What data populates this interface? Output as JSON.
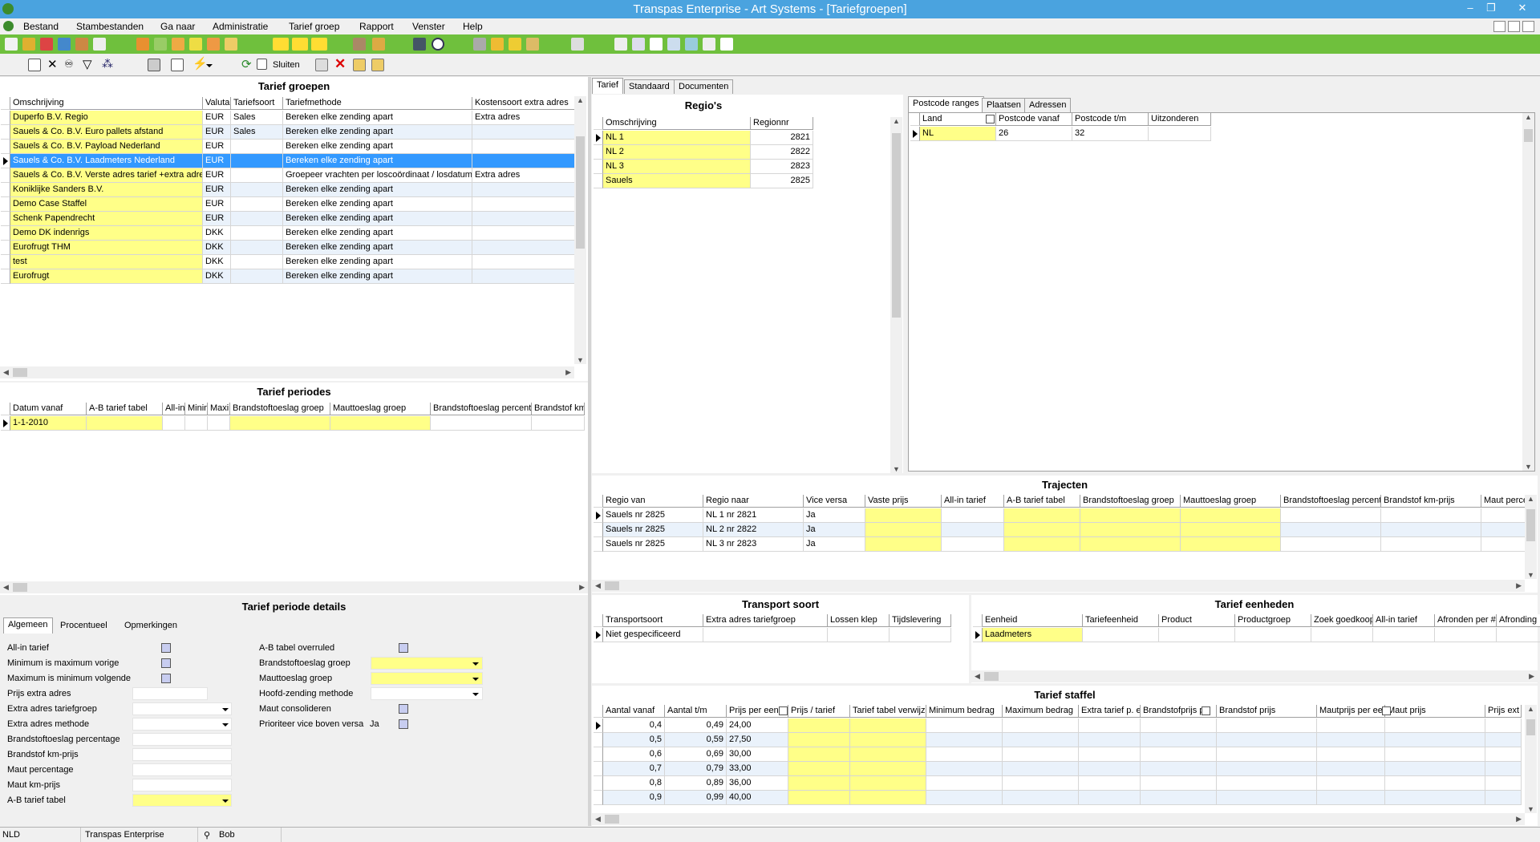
{
  "window": {
    "title": "Transpas Enterprise - Art Systems - [Tariefgroepen]"
  },
  "menu": [
    "Bestand",
    "Stambestanden",
    "Ga naar",
    "Administratie",
    "Tarief groep",
    "Rapport",
    "Venster",
    "Help"
  ],
  "toolbar2": {
    "close_label": "Sluiten"
  },
  "tariefgroepen": {
    "title": "Tarief groepen",
    "columns": [
      "Omschrijving",
      "Valuta",
      "Tariefsoort",
      "Tariefmethode",
      "Kostensoort extra adres"
    ],
    "rows": [
      [
        "Duperfo B.V. Regio",
        "EUR",
        "Sales",
        "Bereken elke zending apart",
        "Extra adres"
      ],
      [
        "Sauels & Co. B.V. Euro pallets afstand",
        "EUR",
        "Sales",
        "Bereken elke zending apart",
        ""
      ],
      [
        "Sauels & Co. B.V. Payload Nederland",
        "EUR",
        "",
        "Bereken elke zending apart",
        ""
      ],
      [
        "Sauels & Co. B.V. Laadmeters Nederland",
        "EUR",
        "",
        "Bereken elke zending apart",
        ""
      ],
      [
        "Sauels & Co. B.V. Verste adres tarief +extra adres",
        "EUR",
        "",
        "Groepeer vrachten per loscoördinaat / losdatum",
        "Extra adres"
      ],
      [
        "Koniklijke Sanders B.V.",
        "EUR",
        "",
        "Bereken elke zending apart",
        ""
      ],
      [
        "Demo Case Staffel",
        "EUR",
        "",
        "Bereken elke zending apart",
        ""
      ],
      [
        "Schenk Papendrecht",
        "EUR",
        "",
        "Bereken elke zending apart",
        ""
      ],
      [
        "Demo DK indenrigs",
        "DKK",
        "",
        "Bereken elke zending apart",
        ""
      ],
      [
        "Eurofrugt THM",
        "DKK",
        "",
        "Bereken elke zending apart",
        ""
      ],
      [
        "test",
        "DKK",
        "",
        "Bereken elke zending apart",
        ""
      ],
      [
        "Eurofrugt",
        "DKK",
        "",
        "Bereken elke zending apart",
        ""
      ]
    ]
  },
  "tariefperiodes": {
    "title": "Tarief periodes",
    "columns": [
      "Datum vanaf",
      "A-B tarief tabel",
      "All-in",
      "Minin",
      "Maxir",
      "Brandstoftoeslag groep",
      "Mauttoeslag groep",
      "Brandstoftoeslag percenta",
      "Brandstof km"
    ],
    "rows": [
      [
        "1-1-2010",
        "",
        "",
        "",
        "",
        "",
        "",
        "",
        ""
      ]
    ]
  },
  "details": {
    "title": "Tarief periode details",
    "tabs": [
      "Algemeen",
      "Procentueel",
      "Opmerkingen"
    ],
    "left_labels": [
      "All-in tarief",
      "Minimum is maximum vorige",
      "Maximum is minimum volgende",
      "Prijs extra adres",
      "Extra adres tariefgroep",
      "Extra adres methode",
      "Brandstoftoeslag percentage",
      "Brandstof km-prijs",
      "Maut percentage",
      "Maut km-prijs",
      "A-B tarief tabel"
    ],
    "right_labels": [
      "A-B tabel overruled",
      "Brandstoftoeslag groep",
      "Mauttoeslag groep",
      "Hoofd-zending methode",
      "Maut consolideren",
      "Prioriteer vice boven versa"
    ],
    "prioriteer_value": "Ja"
  },
  "righttabs": [
    "Tarief",
    "Standaard",
    "Documenten"
  ],
  "regios": {
    "title": "Regio's",
    "columns": [
      "Omschrijving",
      "Regionnr"
    ],
    "rows": [
      [
        "NL 1",
        "2821"
      ],
      [
        "NL 2",
        "2822"
      ],
      [
        "NL 3",
        "2823"
      ],
      [
        "Sauels",
        "2825"
      ]
    ]
  },
  "postcode": {
    "tabs": [
      "Postcode ranges",
      "Plaatsen",
      "Adressen"
    ],
    "columns": [
      "Land",
      "Postcode vanaf",
      "Postcode t/m",
      "Uitzonderen"
    ],
    "rows": [
      [
        "NL",
        "26",
        "32",
        ""
      ]
    ]
  },
  "trajecten": {
    "title": "Trajecten",
    "columns": [
      "Regio van",
      "Regio naar",
      "Vice versa",
      "Vaste prijs",
      "All-in tarief",
      "A-B tarief tabel",
      "Brandstoftoeslag groep",
      "Mauttoeslag groep",
      "Brandstoftoeslag percenta",
      "Brandstof km-prijs",
      "Maut perce"
    ],
    "rows": [
      [
        "Sauels nr 2825",
        "NL 1 nr 2821",
        "Ja"
      ],
      [
        "Sauels nr 2825",
        "NL 2 nr 2822",
        "Ja"
      ],
      [
        "Sauels nr 2825",
        "NL 3 nr 2823",
        "Ja"
      ]
    ]
  },
  "transport": {
    "title": "Transport soort",
    "columns": [
      "Transportsoort",
      "Extra adres tariefgroep",
      "Lossen klep",
      "Tijdslevering"
    ],
    "rows": [
      [
        "Niet gespecificeerd"
      ]
    ]
  },
  "eenheden": {
    "title": "Tarief eenheden",
    "columns": [
      "Eenheid",
      "Tariefeenheid",
      "Product",
      "Productgroep",
      "Zoek goedkoop",
      "All-in tarief",
      "Afronden per #",
      "Afronding"
    ],
    "rows": [
      [
        "Laadmeters"
      ]
    ]
  },
  "staffel": {
    "title": "Tarief staffel",
    "columns": [
      "Aantal vanaf",
      "Aantal t/m",
      "Prijs per eenl",
      "Prijs / tarief",
      "Tarief tabel verwijzi",
      "Minimum bedrag",
      "Maximum bedrag",
      "Extra tarief p. e",
      "Brandstofprijs pe",
      "Brandstof prijs",
      "Mautprijs per eer",
      "Maut prijs",
      "Prijs ext"
    ],
    "rows": [
      [
        "0,4",
        "0,49",
        "24,00"
      ],
      [
        "0,5",
        "0,59",
        "27,50"
      ],
      [
        "0,6",
        "0,69",
        "30,00"
      ],
      [
        "0,7",
        "0,79",
        "33,00"
      ],
      [
        "0,8",
        "0,89",
        "36,00"
      ],
      [
        "0,9",
        "0,99",
        "40,00"
      ]
    ]
  },
  "status": {
    "lang": "NLD",
    "app": "Transpas Enterprise",
    "user": "Bob"
  }
}
